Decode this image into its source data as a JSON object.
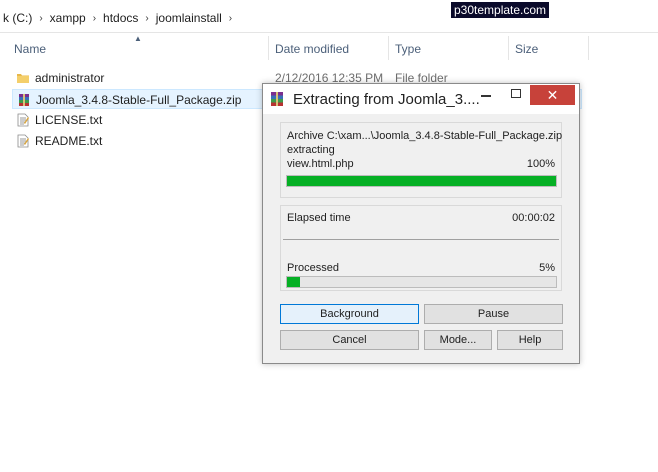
{
  "explorer": {
    "breadcrumbs": [
      "k (C:)",
      "xampp",
      "htdocs",
      "joomlainstall"
    ],
    "watermark": "p30template.com",
    "columns": {
      "name": "Name",
      "date_modified": "Date modified",
      "type": "Type",
      "size": "Size"
    },
    "files": [
      {
        "name": "administrator",
        "date": "2/12/2016 12:35 PM",
        "type": "File folder",
        "icon": "folder-icon"
      },
      {
        "name": "Joomla_3.4.8-Stable-Full_Package.zip",
        "date": "",
        "type": "",
        "icon": "winrar-archive-icon"
      },
      {
        "name": "LICENSE.txt",
        "date": "",
        "type": "",
        "icon": "text-file-icon"
      },
      {
        "name": "README.txt",
        "date": "",
        "type": "",
        "icon": "text-file-icon"
      }
    ]
  },
  "dialog": {
    "title": "Extracting from Joomla_3....",
    "archive_line": "Archive C:\\xam...\\Joomla_3.4.8-Stable-Full_Package.zip",
    "action": "extracting",
    "current_file": "view.html.php",
    "file_percent_label": "100%",
    "file_progress": 1.0,
    "elapsed_label": "Elapsed time",
    "elapsed_value": "00:00:02",
    "processed_label": "Processed",
    "processed_percent_label": "5%",
    "processed_progress": 0.05,
    "buttons": {
      "background": "Background",
      "pause": "Pause",
      "cancel": "Cancel",
      "mode": "Mode...",
      "help": "Help"
    },
    "close_glyph": "✕"
  },
  "colors": {
    "progress_fill": "#06b025",
    "close_button": "#c7423a",
    "selection": "#e5f3ff"
  }
}
